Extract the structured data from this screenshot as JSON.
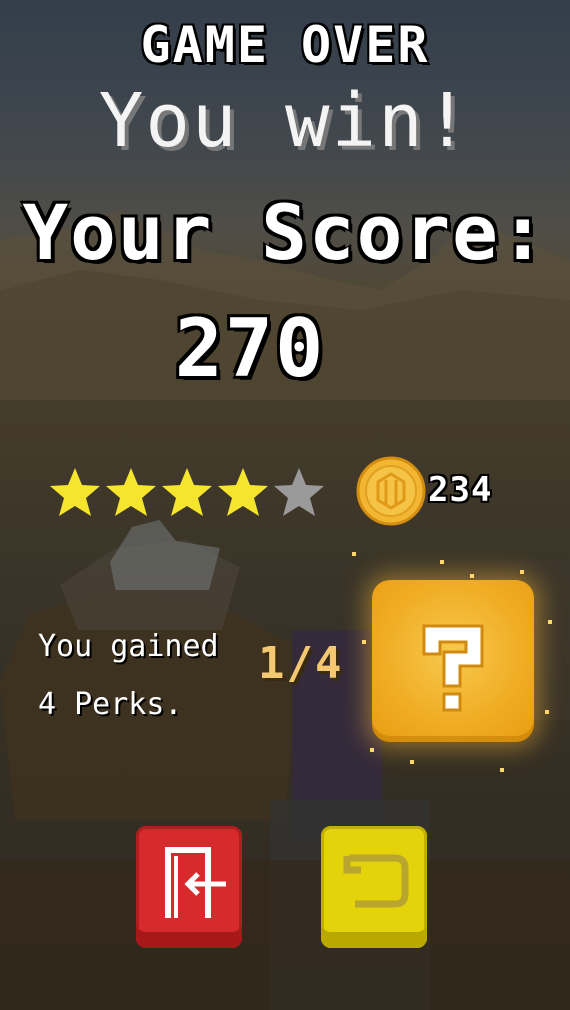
{
  "screen": {
    "title": "GAME OVER",
    "result": "You win!",
    "score_label": "Your Score:",
    "score": "270"
  },
  "rating": {
    "stars_earned": 4,
    "stars_total": 5,
    "star_color": "#f5e52c",
    "empty_star_color": "#9a9a9a"
  },
  "coins": {
    "count": "234",
    "icon": "coin-icon",
    "color": "#f2b632"
  },
  "perks": {
    "line1": "You gained",
    "line2": "4 Perks.",
    "progress": "1/4",
    "mystery_icon": "question-mark-icon"
  },
  "buttons": {
    "exit": {
      "icon": "exit-door-icon",
      "color": "#d62a2c"
    },
    "replay": {
      "icon": "replay-icon",
      "color": "#e4d20a"
    }
  }
}
